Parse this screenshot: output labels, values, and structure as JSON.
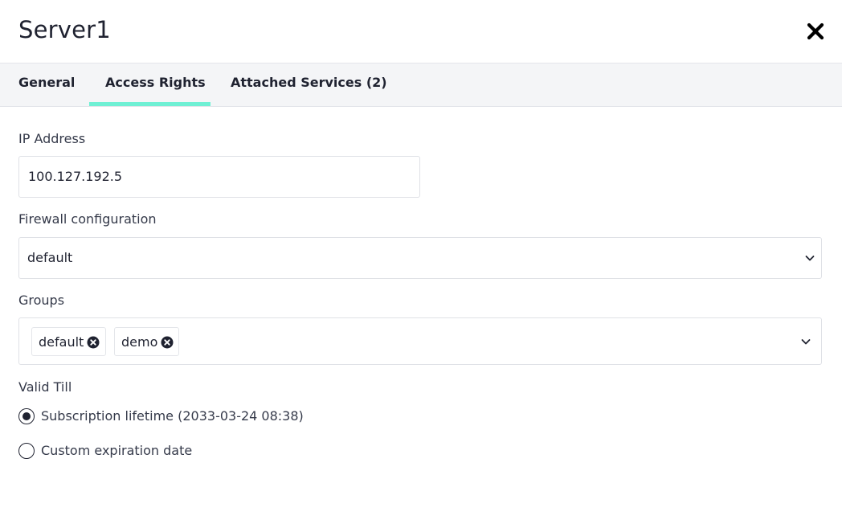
{
  "dialog": {
    "title": "Server1",
    "close_icon": "close-x-icon"
  },
  "tabs": [
    {
      "label": "General",
      "active": false
    },
    {
      "label": "Access Rights",
      "active": true
    },
    {
      "label": "Attached Services (2)",
      "active": false
    }
  ],
  "accent_color": "#6ff0d4",
  "form": {
    "ip_address": {
      "label": "IP Address",
      "value": "100.127.192.5"
    },
    "firewall": {
      "label": "Firewall configuration",
      "value": "default"
    },
    "groups": {
      "label": "Groups",
      "chips": [
        {
          "label": "default",
          "remove_icon": "remove-circle-icon"
        },
        {
          "label": "demo",
          "remove_icon": "remove-circle-icon"
        }
      ]
    },
    "valid_till": {
      "label": "Valid Till",
      "options": [
        {
          "label": "Subscription lifetime (2033-03-24 08:38)",
          "checked": true
        },
        {
          "label": "Custom expiration date",
          "checked": false
        }
      ]
    }
  }
}
